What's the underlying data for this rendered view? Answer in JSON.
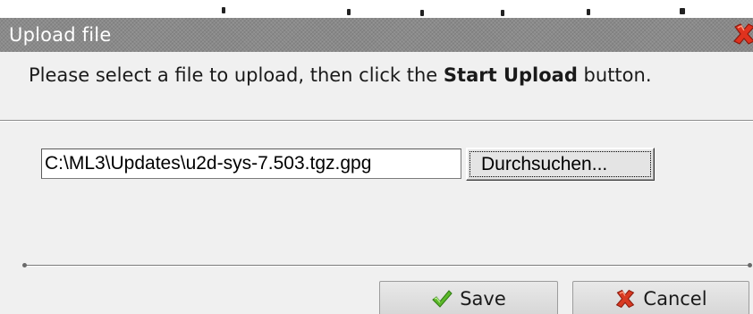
{
  "dialog": {
    "title": "Upload file",
    "message_prefix": "Please select a file to upload, then click the ",
    "message_bold": "Start Upload",
    "message_suffix": " button."
  },
  "file_input": {
    "value": "C:\\ML3\\Updates\\u2d-sys-7.503.tgz.gpg"
  },
  "browse_button": {
    "label": "Durchsuchen..."
  },
  "footer": {
    "save_label": "Save",
    "cancel_label": "Cancel"
  },
  "icons": {
    "close": "close-icon",
    "save": "checkmark-icon",
    "cancel": "x-cross-icon"
  },
  "colors": {
    "titlebar": "#8a8a8a",
    "close_red": "#e0321e",
    "check_green": "#5cb82a",
    "cancel_red": "#d83a22"
  }
}
